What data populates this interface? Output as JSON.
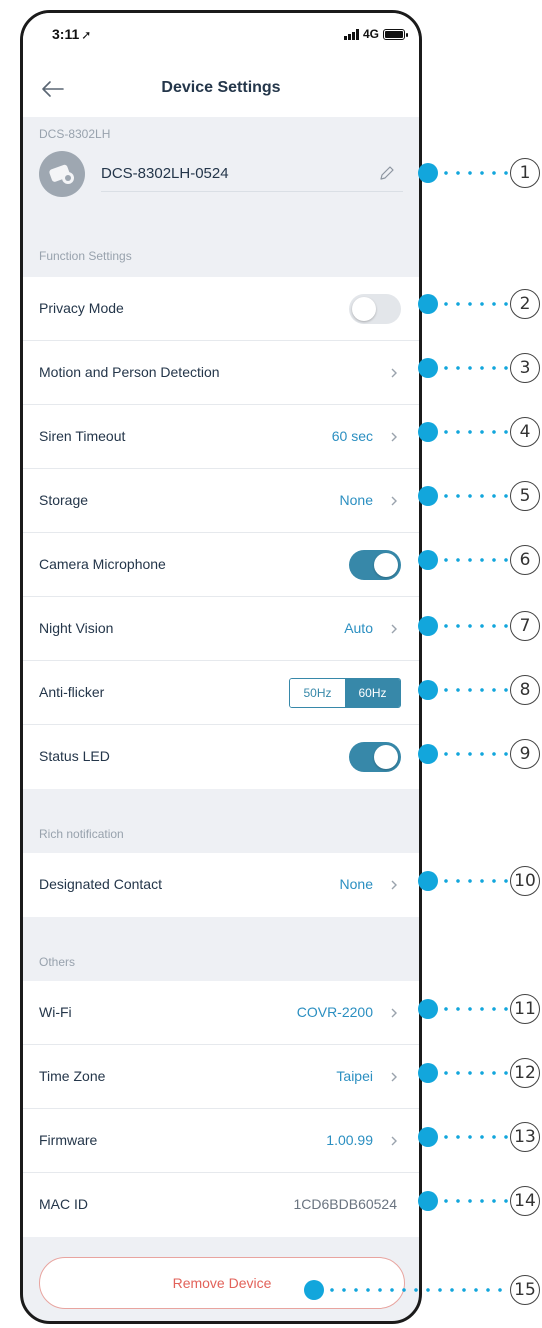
{
  "status_bar": {
    "time": "3:11",
    "location_glyph": "➚",
    "network": "4G"
  },
  "header": {
    "title": "Device Settings",
    "back_icon": "arrow-left-icon"
  },
  "device": {
    "section_label": "DCS-8302LH",
    "name": "DCS-8302LH-0524",
    "edit_icon": "pencil-icon"
  },
  "function_settings": {
    "section_label": "Function Settings",
    "privacy_mode": {
      "label": "Privacy Mode",
      "enabled": false
    },
    "motion_detection": {
      "label": "Motion and Person Detection"
    },
    "siren_timeout": {
      "label": "Siren Timeout",
      "value": "60 sec"
    },
    "storage": {
      "label": "Storage",
      "value": "None"
    },
    "camera_microphone": {
      "label": "Camera Microphone",
      "enabled": true
    },
    "night_vision": {
      "label": "Night Vision",
      "value": "Auto"
    },
    "anti_flicker": {
      "label": "Anti-flicker",
      "options": [
        "50Hz",
        "60Hz"
      ],
      "selected": "60Hz"
    },
    "status_led": {
      "label": "Status LED",
      "enabled": true
    }
  },
  "rich_notification": {
    "section_label": "Rich notification",
    "designated_contact": {
      "label": "Designated Contact",
      "value": "None"
    }
  },
  "others": {
    "section_label": "Others",
    "wifi": {
      "label": "Wi-Fi",
      "value": "COVR-2200"
    },
    "time_zone": {
      "label": "Time Zone",
      "value": "Taipei"
    },
    "firmware": {
      "label": "Firmware",
      "value": "1.00.99"
    },
    "mac_id": {
      "label": "MAC ID",
      "value": "1CD6BDB60524"
    }
  },
  "remove_device": {
    "label": "Remove Device"
  },
  "callouts": [
    "1",
    "2",
    "3",
    "4",
    "5",
    "6",
    "7",
    "8",
    "9",
    "10",
    "11",
    "12",
    "13",
    "14",
    "15"
  ],
  "colors": {
    "accent": "#3788a9",
    "link": "#2b8fc1",
    "danger": "#e2625a",
    "callout": "#12a6dc",
    "background": "#eef0f4"
  }
}
